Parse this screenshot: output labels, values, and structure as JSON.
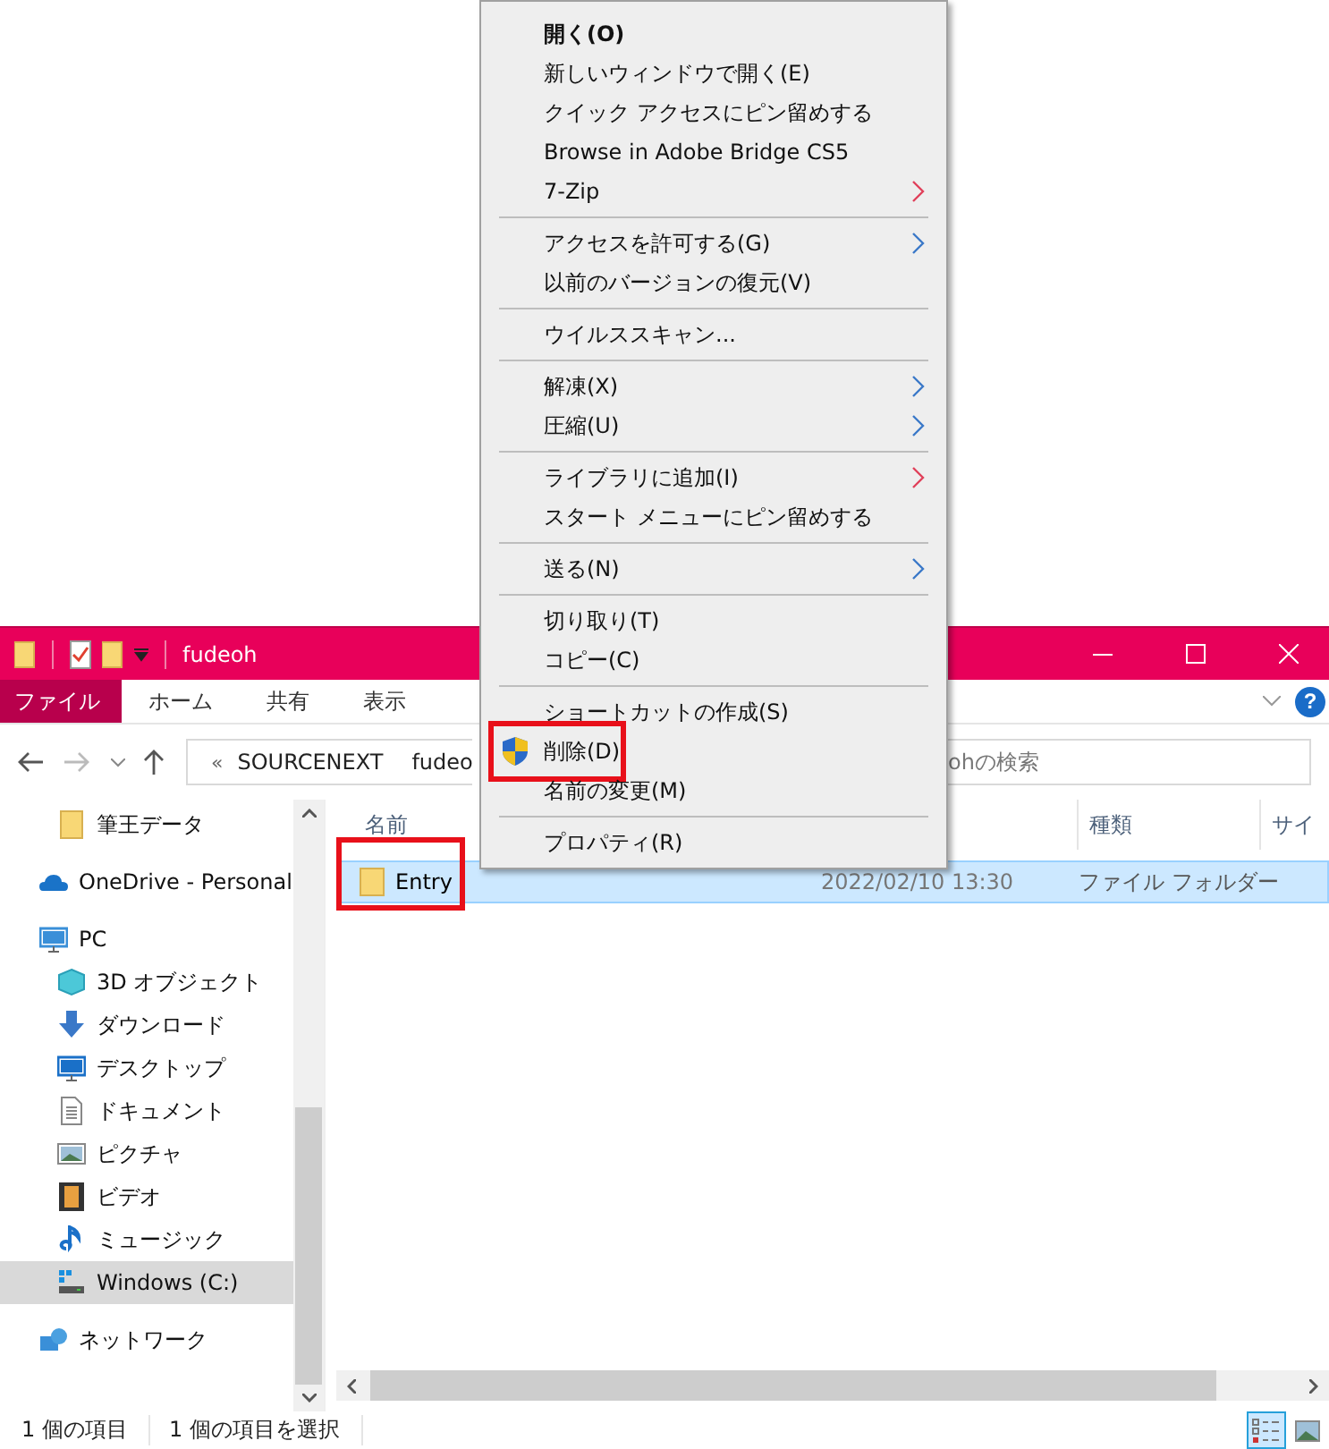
{
  "window": {
    "title": "fudeoh"
  },
  "help_button": "?",
  "ribbon_tabs": [
    {
      "label": "ファイル",
      "selected": true
    },
    {
      "label": "ホーム",
      "selected": false
    },
    {
      "label": "共有",
      "selected": false
    },
    {
      "label": "表示",
      "selected": false
    }
  ],
  "address": {
    "prefix": "«",
    "segments": [
      "SOURCENEXT",
      "fudeo"
    ]
  },
  "search": {
    "placeholder": "ohの検索"
  },
  "sidebar": {
    "items": [
      {
        "label": "筆王データ",
        "selected": false
      },
      {
        "label": "OneDrive - Personal",
        "selected": false
      },
      {
        "label": "PC",
        "selected": false,
        "children": [
          {
            "label": "3D オブジェクト",
            "selected": false
          },
          {
            "label": "ダウンロード",
            "selected": false
          },
          {
            "label": "デスクトップ",
            "selected": false
          },
          {
            "label": "ドキュメント",
            "selected": false
          },
          {
            "label": "ピクチャ",
            "selected": false
          },
          {
            "label": "ビデオ",
            "selected": false
          },
          {
            "label": "ミュージック",
            "selected": false
          },
          {
            "label": "Windows (C:)",
            "selected": true
          }
        ]
      },
      {
        "label": "ネットワーク",
        "selected": false
      }
    ]
  },
  "table": {
    "columns": [
      "名前",
      "種類",
      "サイ"
    ],
    "rows": [
      {
        "name": "Entry",
        "modified": "2022/02/10 13:30",
        "type": "ファイル フォルダー",
        "selected": true,
        "highlighted": true
      }
    ]
  },
  "context_menu": {
    "groups": [
      [
        {
          "label": "開く(O)",
          "bold": true,
          "submenu": false
        },
        {
          "label": "新しいウィンドウで開く(E)",
          "bold": false,
          "submenu": false
        },
        {
          "label": "クイック アクセスにピン留めする",
          "bold": false,
          "submenu": false
        },
        {
          "label": "Browse in Adobe Bridge CS5",
          "bold": false,
          "submenu": false
        },
        {
          "label": "7-Zip",
          "bold": false,
          "submenu": true,
          "color": "#e0405a"
        }
      ],
      [
        {
          "label": "アクセスを許可する(G)",
          "bold": false,
          "submenu": true,
          "color": "#3a78c8"
        },
        {
          "label": "以前のバージョンの復元(V)",
          "bold": false,
          "submenu": false
        }
      ],
      [
        {
          "label": "ウイルススキャン...",
          "bold": false,
          "submenu": false
        }
      ],
      [
        {
          "label": "解凍(X)",
          "bold": false,
          "submenu": true,
          "color": "#3a78c8"
        },
        {
          "label": "圧縮(U)",
          "bold": false,
          "submenu": true,
          "color": "#3a78c8"
        }
      ],
      [
        {
          "label": "ライブラリに追加(I)",
          "bold": false,
          "submenu": true,
          "color": "#e0405a"
        },
        {
          "label": "スタート メニューにピン留めする",
          "bold": false,
          "submenu": false
        }
      ],
      [
        {
          "label": "送る(N)",
          "bold": false,
          "submenu": true,
          "color": "#3a78c8"
        }
      ],
      [
        {
          "label": "切り取り(T)",
          "bold": false,
          "submenu": false
        },
        {
          "label": "コピー(C)",
          "bold": false,
          "submenu": false
        }
      ],
      [
        {
          "label": "ショートカットの作成(S)",
          "bold": false,
          "submenu": false
        },
        {
          "label": "削除(D)",
          "bold": false,
          "submenu": false,
          "shield": true,
          "highlighted": true
        },
        {
          "label": "名前の変更(M)",
          "bold": false,
          "submenu": false
        }
      ],
      [
        {
          "label": "プロパティ(R)",
          "bold": false,
          "submenu": false
        }
      ]
    ]
  },
  "status_bar": {
    "items": [
      "1 個の項目",
      "1 個の項目を選択"
    ]
  }
}
